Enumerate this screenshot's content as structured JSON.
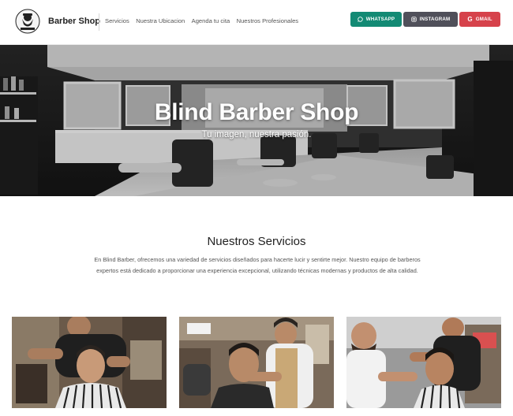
{
  "navbar": {
    "logo_icon": "barber-logo-icon",
    "brand": "Barber Shop",
    "links": [
      "Servicios",
      "Nuestra Ubicacion",
      "Agenda tu cita",
      "Nuestros Profesionales"
    ],
    "buttons": [
      {
        "label": "WHATSAPP",
        "icon": "whatsapp-icon",
        "color": "#138a74"
      },
      {
        "label": "INSTAGRAM",
        "icon": "instagram-icon",
        "color": "#50505a"
      },
      {
        "label": "GMAIL",
        "icon": "google-icon",
        "color": "#d6424b"
      }
    ]
  },
  "hero": {
    "title": "Blind Barber Shop",
    "subtitle": "Tu imagen, nuestra pasión."
  },
  "services": {
    "title": "Nuestros Servicios",
    "description": "En Blind Barber, ofrecemos una variedad de servicios diseñados para hacerte lucir y sentirte mejor. Nuestro equipo de barberos expertos está dedicado a proporcionar una experiencia excepcional, utilizando técnicas modernas y productos de alta calidad.",
    "cards": [
      {
        "image": "barber-haircut-photo"
      },
      {
        "image": "barber-haircut-photo"
      },
      {
        "image": "barber-haircut-photo"
      }
    ]
  }
}
